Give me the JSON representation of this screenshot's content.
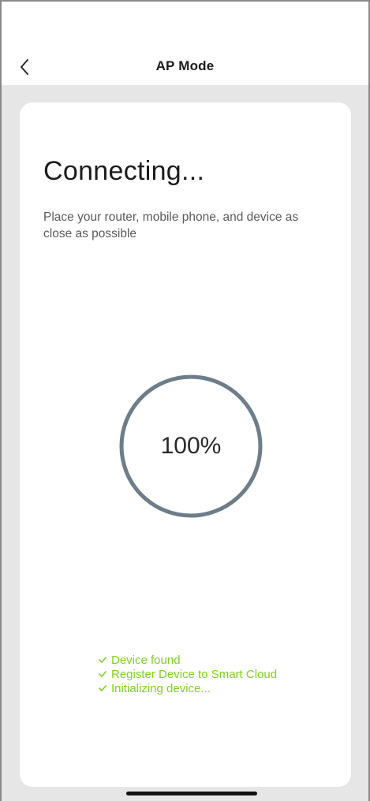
{
  "header": {
    "title": "AP Mode",
    "back_icon": "chevron-left-icon"
  },
  "main": {
    "title": "Connecting...",
    "subtitle": "Place your router, mobile phone, and device as close as possible",
    "progress": {
      "percent": 100,
      "label": "100%",
      "ring_color": "#6e7d8a"
    },
    "status_items": [
      {
        "label": "Device found",
        "icon": "check-icon"
      },
      {
        "label": "Register Device to Smart Cloud",
        "icon": "check-icon"
      },
      {
        "label": "Initializing device...",
        "icon": "check-icon"
      }
    ],
    "status_color": "#7ed321"
  }
}
